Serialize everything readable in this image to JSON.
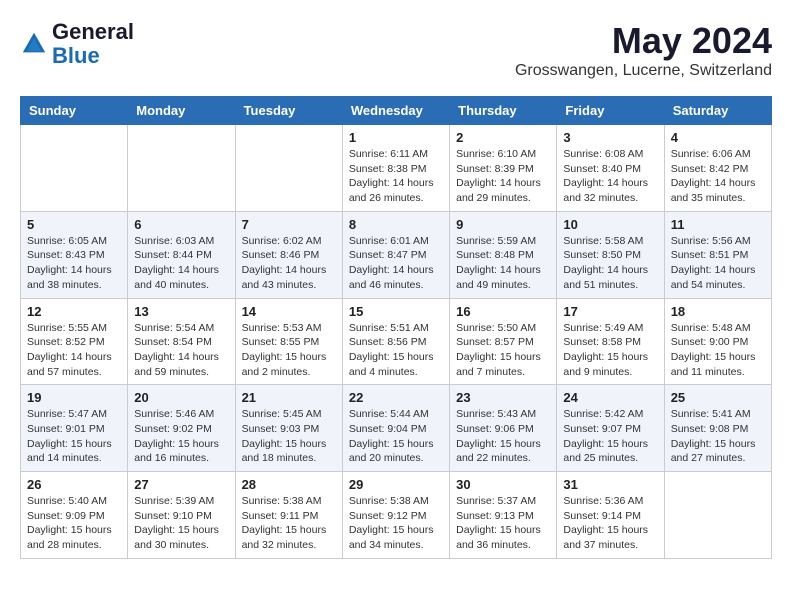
{
  "header": {
    "logo_line1": "General",
    "logo_line2": "Blue",
    "month_title": "May 2024",
    "location": "Grosswangen, Lucerne, Switzerland"
  },
  "days_of_week": [
    "Sunday",
    "Monday",
    "Tuesday",
    "Wednesday",
    "Thursday",
    "Friday",
    "Saturday"
  ],
  "weeks": [
    [
      {
        "day": "",
        "info": ""
      },
      {
        "day": "",
        "info": ""
      },
      {
        "day": "",
        "info": ""
      },
      {
        "day": "1",
        "info": "Sunrise: 6:11 AM\nSunset: 8:38 PM\nDaylight: 14 hours\nand 26 minutes."
      },
      {
        "day": "2",
        "info": "Sunrise: 6:10 AM\nSunset: 8:39 PM\nDaylight: 14 hours\nand 29 minutes."
      },
      {
        "day": "3",
        "info": "Sunrise: 6:08 AM\nSunset: 8:40 PM\nDaylight: 14 hours\nand 32 minutes."
      },
      {
        "day": "4",
        "info": "Sunrise: 6:06 AM\nSunset: 8:42 PM\nDaylight: 14 hours\nand 35 minutes."
      }
    ],
    [
      {
        "day": "5",
        "info": "Sunrise: 6:05 AM\nSunset: 8:43 PM\nDaylight: 14 hours\nand 38 minutes."
      },
      {
        "day": "6",
        "info": "Sunrise: 6:03 AM\nSunset: 8:44 PM\nDaylight: 14 hours\nand 40 minutes."
      },
      {
        "day": "7",
        "info": "Sunrise: 6:02 AM\nSunset: 8:46 PM\nDaylight: 14 hours\nand 43 minutes."
      },
      {
        "day": "8",
        "info": "Sunrise: 6:01 AM\nSunset: 8:47 PM\nDaylight: 14 hours\nand 46 minutes."
      },
      {
        "day": "9",
        "info": "Sunrise: 5:59 AM\nSunset: 8:48 PM\nDaylight: 14 hours\nand 49 minutes."
      },
      {
        "day": "10",
        "info": "Sunrise: 5:58 AM\nSunset: 8:50 PM\nDaylight: 14 hours\nand 51 minutes."
      },
      {
        "day": "11",
        "info": "Sunrise: 5:56 AM\nSunset: 8:51 PM\nDaylight: 14 hours\nand 54 minutes."
      }
    ],
    [
      {
        "day": "12",
        "info": "Sunrise: 5:55 AM\nSunset: 8:52 PM\nDaylight: 14 hours\nand 57 minutes."
      },
      {
        "day": "13",
        "info": "Sunrise: 5:54 AM\nSunset: 8:54 PM\nDaylight: 14 hours\nand 59 minutes."
      },
      {
        "day": "14",
        "info": "Sunrise: 5:53 AM\nSunset: 8:55 PM\nDaylight: 15 hours\nand 2 minutes."
      },
      {
        "day": "15",
        "info": "Sunrise: 5:51 AM\nSunset: 8:56 PM\nDaylight: 15 hours\nand 4 minutes."
      },
      {
        "day": "16",
        "info": "Sunrise: 5:50 AM\nSunset: 8:57 PM\nDaylight: 15 hours\nand 7 minutes."
      },
      {
        "day": "17",
        "info": "Sunrise: 5:49 AM\nSunset: 8:58 PM\nDaylight: 15 hours\nand 9 minutes."
      },
      {
        "day": "18",
        "info": "Sunrise: 5:48 AM\nSunset: 9:00 PM\nDaylight: 15 hours\nand 11 minutes."
      }
    ],
    [
      {
        "day": "19",
        "info": "Sunrise: 5:47 AM\nSunset: 9:01 PM\nDaylight: 15 hours\nand 14 minutes."
      },
      {
        "day": "20",
        "info": "Sunrise: 5:46 AM\nSunset: 9:02 PM\nDaylight: 15 hours\nand 16 minutes."
      },
      {
        "day": "21",
        "info": "Sunrise: 5:45 AM\nSunset: 9:03 PM\nDaylight: 15 hours\nand 18 minutes."
      },
      {
        "day": "22",
        "info": "Sunrise: 5:44 AM\nSunset: 9:04 PM\nDaylight: 15 hours\nand 20 minutes."
      },
      {
        "day": "23",
        "info": "Sunrise: 5:43 AM\nSunset: 9:06 PM\nDaylight: 15 hours\nand 22 minutes."
      },
      {
        "day": "24",
        "info": "Sunrise: 5:42 AM\nSunset: 9:07 PM\nDaylight: 15 hours\nand 25 minutes."
      },
      {
        "day": "25",
        "info": "Sunrise: 5:41 AM\nSunset: 9:08 PM\nDaylight: 15 hours\nand 27 minutes."
      }
    ],
    [
      {
        "day": "26",
        "info": "Sunrise: 5:40 AM\nSunset: 9:09 PM\nDaylight: 15 hours\nand 28 minutes."
      },
      {
        "day": "27",
        "info": "Sunrise: 5:39 AM\nSunset: 9:10 PM\nDaylight: 15 hours\nand 30 minutes."
      },
      {
        "day": "28",
        "info": "Sunrise: 5:38 AM\nSunset: 9:11 PM\nDaylight: 15 hours\nand 32 minutes."
      },
      {
        "day": "29",
        "info": "Sunrise: 5:38 AM\nSunset: 9:12 PM\nDaylight: 15 hours\nand 34 minutes."
      },
      {
        "day": "30",
        "info": "Sunrise: 5:37 AM\nSunset: 9:13 PM\nDaylight: 15 hours\nand 36 minutes."
      },
      {
        "day": "31",
        "info": "Sunrise: 5:36 AM\nSunset: 9:14 PM\nDaylight: 15 hours\nand 37 minutes."
      },
      {
        "day": "",
        "info": ""
      }
    ]
  ]
}
